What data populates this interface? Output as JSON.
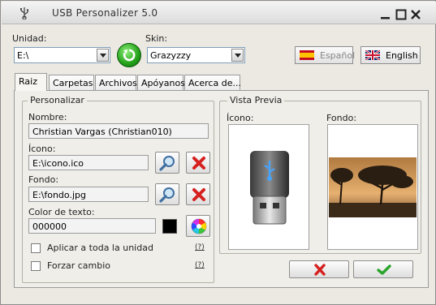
{
  "window": {
    "title": "USB Personalizer 5.0"
  },
  "top": {
    "unidad_label": "Unidad:",
    "unidad_value": "E:\\",
    "skin_label": "Skin:",
    "skin_value": "Grazyzzy",
    "lang_es": "Español",
    "lang_en": "English"
  },
  "tabs": [
    "Raiz",
    "Carpetas",
    "Archivos",
    "Apóyanos",
    "Acerca de..."
  ],
  "personalizar": {
    "title": "Personalizar",
    "nombre_label": "Nombre:",
    "nombre_value": "Christian Vargas (Christian010)",
    "icono_label": "Ícono:",
    "icono_value": "E:\\icono.ico",
    "fondo_label": "Fondo:",
    "fondo_value": "E:\\fondo.jpg",
    "color_label": "Color de texto:",
    "color_value": "000000",
    "aplicar_label": "Aplicar a toda la unidad",
    "forzar_label": "Forzar cambio",
    "help_text": "(?)"
  },
  "preview": {
    "title": "Vista Previa",
    "icono_label": "Ícono:",
    "fondo_label": "Fondo:"
  },
  "colors": {
    "swatch": "#000000",
    "cancel_red": "#d62020",
    "ok_green": "#2aa52a"
  },
  "icons": [
    "usb-icon",
    "minimize-icon",
    "maximize-icon",
    "close-icon",
    "refresh-icon",
    "spain-flag-icon",
    "uk-flag-icon",
    "search-icon",
    "delete-icon",
    "color-wheel-icon",
    "cancel-icon",
    "check-icon"
  ]
}
